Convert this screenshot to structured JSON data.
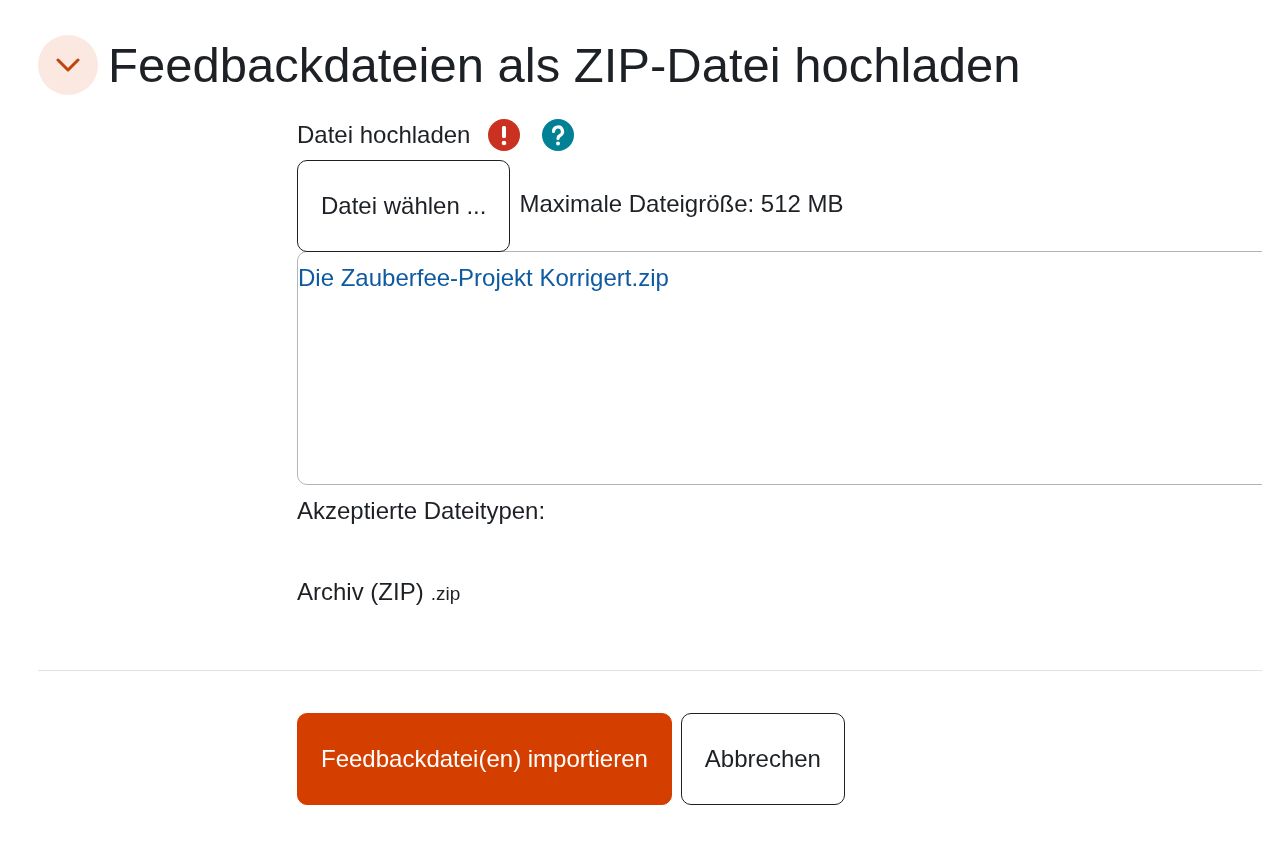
{
  "section": {
    "title": "Feedbackdateien als ZIP-Datei hochladen",
    "expanded": true
  },
  "field": {
    "label": "Datei hochladen",
    "choose_button": "Datei wählen ...",
    "max_size": "Maximale Dateigröße: 512 MB",
    "files": [
      {
        "name": "Die Zauberfee-Projekt Korrigert.zip"
      }
    ],
    "accepted_label": "Akzeptierte Dateitypen:",
    "accepted_types": [
      {
        "label": "Archiv (ZIP)",
        "extension": ".zip"
      }
    ]
  },
  "buttons": [
    {
      "label": "Feedbackdatei(en) importieren",
      "kind": "primary"
    },
    {
      "label": "Abbrechen",
      "kind": "secondary"
    }
  ]
}
